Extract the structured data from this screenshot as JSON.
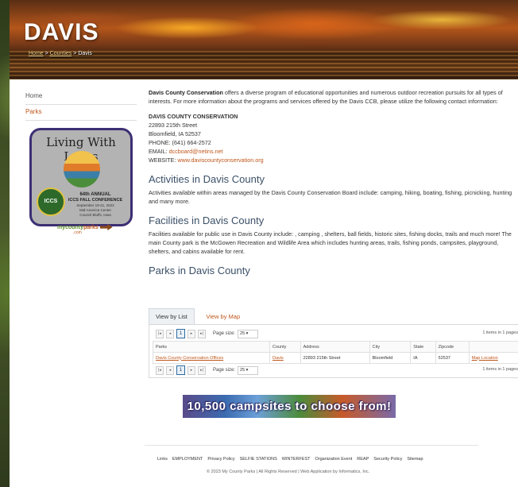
{
  "banner": {
    "title": "DAVIS",
    "breadcrumb": [
      "Home",
      "Counties",
      "Davis"
    ],
    "sep": ">"
  },
  "sidebar": {
    "items": [
      {
        "label": "Home"
      },
      {
        "label": "Parks"
      }
    ],
    "promo": {
      "title": "Living With Loess",
      "seal": "ICCS",
      "line1": "64th ANNUAL",
      "line2": "ICCS FALL CONFERENCE",
      "line3": "September 19-21, 2023",
      "line4": "Mid-America Center",
      "line5": "Council Bluffs, Iowa"
    },
    "logo": {
      "a": "mycounty",
      "b": "parks",
      "c": ".com"
    }
  },
  "main": {
    "intro_bold": "Davis County Conservation",
    "intro_rest": " offers a diverse program of educational opportunities and numerous outdoor recreation pursuits for all types of interests. For more information about the programs and services offered by the Davis CCB, please utilize the following contact information:",
    "contact": {
      "head": "DAVIS COUNTY CONSERVATION",
      "street": "22893 215th Street",
      "city": "Bloomfield, IA 52537",
      "phone": "PHONE: (641) 664-2572",
      "email_label": "EMAIL: ",
      "email": "dccboard@netins.net",
      "website_label": "WEBSITE: ",
      "website": "www.daviscountyconservation.org"
    },
    "activities_heading": "Activities in Davis County",
    "activities_text": "Activities available within areas managed by the Davis County Conservation Board include: camping, hiking, boating, fishing, picnicking, hunting and many more.",
    "facilities_heading": "Facilities in Davis County",
    "facilities_text": "Facilities available for public use in Davis County include: , camping , shelters, ball fields, historic sites, fishing docks, trails and much more!   The main County park is the McGowen Recreation and Wildlife Area which includes hunting areas, trails, fishing ponds, campsites, playground, shelters, and cabins available for rent.",
    "parks_heading": "Parks in Davis County"
  },
  "tabs": [
    {
      "label": "View by List"
    },
    {
      "label": "View by Map"
    }
  ],
  "grid": {
    "page_size_label": "Page size:",
    "page_size": "25",
    "current_page": "1",
    "info": "1 items in 1 pages",
    "columns": [
      "Parks",
      "County",
      "Address",
      "City",
      "State",
      "Zipcode",
      ""
    ],
    "rows": [
      [
        "Davis County Conservation Offices",
        "Davis",
        "22893 215th Street",
        "Bloomfield",
        "IA",
        "52537",
        "Map Location"
      ]
    ]
  },
  "ad": {
    "text": "10,500 campsites to choose from!"
  },
  "footer": {
    "links": [
      "Links",
      "EMPLOYMENT",
      "Privacy Policy",
      "SELFIE STATIONS",
      "WINTERFEST",
      "Organization Event",
      "REAP",
      "Security Policy",
      "Sitemap"
    ],
    "copyright": "© 2023 My County Parks | All Rights Reserved | Web Application by Informatics, Inc."
  }
}
